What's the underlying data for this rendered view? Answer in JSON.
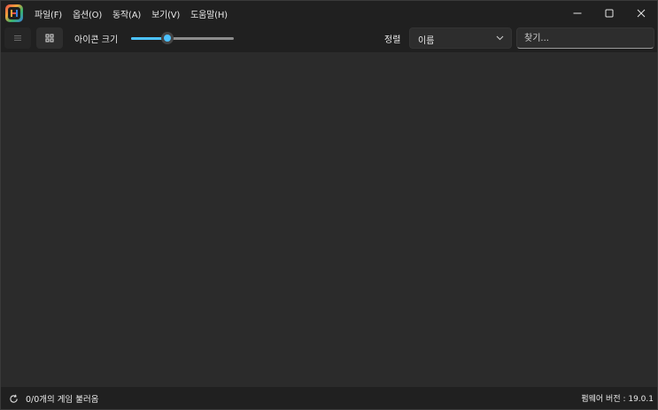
{
  "menu": {
    "items": [
      "파일(F)",
      "옵션(O)",
      "동작(A)",
      "보기(V)",
      "도움말(H)"
    ]
  },
  "toolbar": {
    "icon_size_label": "아이콘 크기",
    "icon_size_value_fraction": 0.35,
    "sort_label": "정렬",
    "sort_value": "이름",
    "search_placeholder": "찾기..."
  },
  "status": {
    "games_loaded": "0/0개의 게임 불러옴",
    "firmware_version": "펌웨어 버전 : 19.0.1"
  },
  "colors": {
    "accent": "#4cc2ff",
    "background": "#2b2b2b",
    "chrome": "#202020"
  },
  "icons": {
    "app": "app-logo-icon",
    "list_view": "list-view-icon",
    "grid_view": "grid-view-icon",
    "dropdown": "chevron-down-icon",
    "refresh": "refresh-icon",
    "minimize": "minimize-icon",
    "maximize": "maximize-icon",
    "close": "close-icon"
  }
}
